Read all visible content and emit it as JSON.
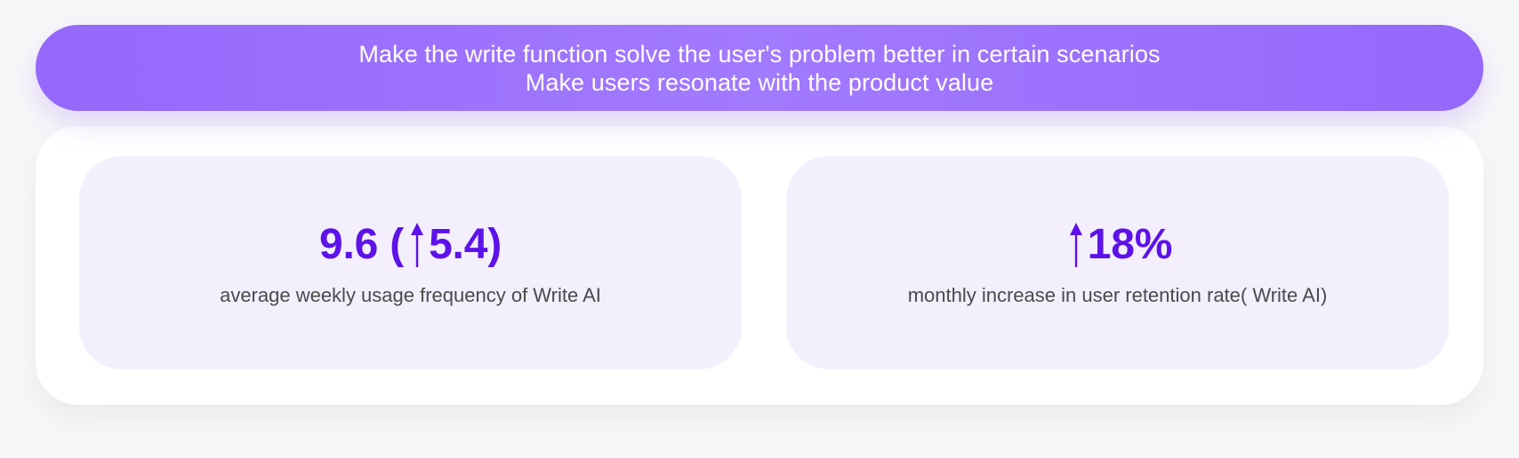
{
  "banner": {
    "line1": "Make the write function solve the user's problem better in certain scenarios",
    "line2": "Make users resonate with the product value"
  },
  "cards": [
    {
      "prefix": "9.6 (",
      "arrow_icon": "arrow-up-icon",
      "suffix": "5.4)",
      "caption": "average weekly usage frequency of Write AI"
    },
    {
      "arrow_icon": "arrow-up-icon",
      "suffix": "18%",
      "caption": "monthly increase in user retention rate( Write AI)"
    }
  ],
  "colors": {
    "accent": "#5D12EA",
    "banner": "#9D72FD",
    "card_bg": "#F3EFFD",
    "panel_bg": "#FFFFFF"
  }
}
